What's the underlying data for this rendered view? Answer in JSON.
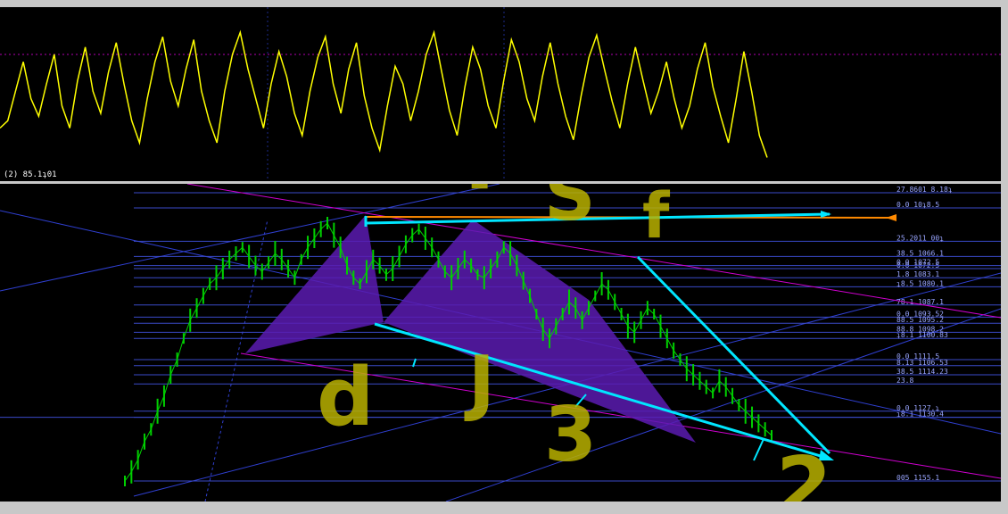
{
  "oscillator": {
    "label": "(2) 85.1ʇ01",
    "color": "#ffff00",
    "values": [
      0.3,
      0.35,
      0.55,
      0.75,
      0.5,
      0.38,
      0.6,
      0.8,
      0.45,
      0.3,
      0.62,
      0.85,
      0.55,
      0.4,
      0.68,
      0.88,
      0.6,
      0.35,
      0.2,
      0.5,
      0.75,
      0.92,
      0.62,
      0.45,
      0.7,
      0.9,
      0.55,
      0.35,
      0.2,
      0.55,
      0.8,
      0.95,
      0.7,
      0.5,
      0.3,
      0.6,
      0.82,
      0.65,
      0.4,
      0.25,
      0.55,
      0.78,
      0.92,
      0.6,
      0.4,
      0.7,
      0.88,
      0.52,
      0.3,
      0.15,
      0.45,
      0.72,
      0.6,
      0.35,
      0.55,
      0.8,
      0.95,
      0.68,
      0.42,
      0.25,
      0.58,
      0.85,
      0.7,
      0.45,
      0.3,
      0.62,
      0.9,
      0.75,
      0.5,
      0.35,
      0.65,
      0.88,
      0.6,
      0.38,
      0.22,
      0.52,
      0.78,
      0.93,
      0.7,
      0.48,
      0.3,
      0.6,
      0.85,
      0.62,
      0.4,
      0.55,
      0.75,
      0.5,
      0.3,
      0.45,
      0.7,
      0.88,
      0.58,
      0.38,
      0.2,
      0.5,
      0.82,
      0.55,
      0.25,
      0.1
    ],
    "midline": 0.8
  },
  "price": {
    "candle_color": "#00d000",
    "values": [
      0.05,
      0.08,
      0.12,
      0.18,
      0.22,
      0.28,
      0.33,
      0.4,
      0.45,
      0.52,
      0.58,
      0.62,
      0.66,
      0.7,
      0.72,
      0.75,
      0.78,
      0.8,
      0.82,
      0.79,
      0.76,
      0.74,
      0.77,
      0.8,
      0.78,
      0.75,
      0.72,
      0.78,
      0.82,
      0.85,
      0.88,
      0.9,
      0.86,
      0.82,
      0.76,
      0.72,
      0.7,
      0.74,
      0.78,
      0.76,
      0.73,
      0.75,
      0.79,
      0.83,
      0.86,
      0.88,
      0.85,
      0.82,
      0.78,
      0.74,
      0.72,
      0.75,
      0.78,
      0.76,
      0.73,
      0.72,
      0.75,
      0.78,
      0.82,
      0.8,
      0.76,
      0.71,
      0.66,
      0.6,
      0.55,
      0.52,
      0.56,
      0.6,
      0.64,
      0.62,
      0.58,
      0.62,
      0.66,
      0.7,
      0.68,
      0.64,
      0.6,
      0.56,
      0.54,
      0.58,
      0.62,
      0.6,
      0.56,
      0.52,
      0.48,
      0.45,
      0.42,
      0.4,
      0.38,
      0.36,
      0.34,
      0.38,
      0.36,
      0.33,
      0.3,
      0.28,
      0.26,
      0.24,
      0.22,
      0.2
    ]
  },
  "levels": [
    {
      "label": "27.8601 8.18ʇ",
      "value": 1.0
    },
    {
      "label": "0.0 10ʇ8.5",
      "value": 0.95
    },
    {
      "label": "25.2011 00ʇ",
      "value": 0.84
    },
    {
      "label": "38.5 1066.1",
      "value": 0.79
    },
    {
      "label": "0.0 1072.5",
      "value": 0.75
    },
    {
      "label": "1.8 1083.1",
      "value": 0.72
    },
    {
      "label": "0.0 1072.5",
      "value": 0.76
    },
    {
      "label": "ʇ8.5 1080.1",
      "value": 0.69
    },
    {
      "label": "78.1 1087.1",
      "value": 0.63
    },
    {
      "label": "0.0 1093.52",
      "value": 0.59
    },
    {
      "label": "88.5 1095.2",
      "value": 0.57
    },
    {
      "label": "88.8 1098.2",
      "value": 0.54
    },
    {
      "label": "ʇ8.1 1100.83",
      "value": 0.52
    },
    {
      "label": "0.0 1111.5",
      "value": 0.45
    },
    {
      "label": "8.13 1106.53",
      "value": 0.43
    },
    {
      "label": "38.5 1114.23",
      "value": 0.4
    },
    {
      "label": "23.8",
      "value": 0.37
    },
    {
      "label": "0.0 1127.ʇ",
      "value": 0.28
    },
    {
      "label": "ʇ8.1 1130.4",
      "value": 0.26
    },
    {
      "label": "005 1155.1",
      "value": 0.05
    }
  ],
  "annotations": {
    "letter_p": "P",
    "letter_s": "S",
    "letter_f": "f",
    "letter_d": "d",
    "letter_j": "J",
    "letter_3": "3",
    "letter_2": "2",
    "color": "#b8b000"
  },
  "colors": {
    "level_line": "#3a4ac8",
    "trend_cyan": "#00e6ff",
    "trend_orange": "#ff8a00",
    "trend_magenta": "#d000d0",
    "triangle": "#5a1bb0"
  }
}
